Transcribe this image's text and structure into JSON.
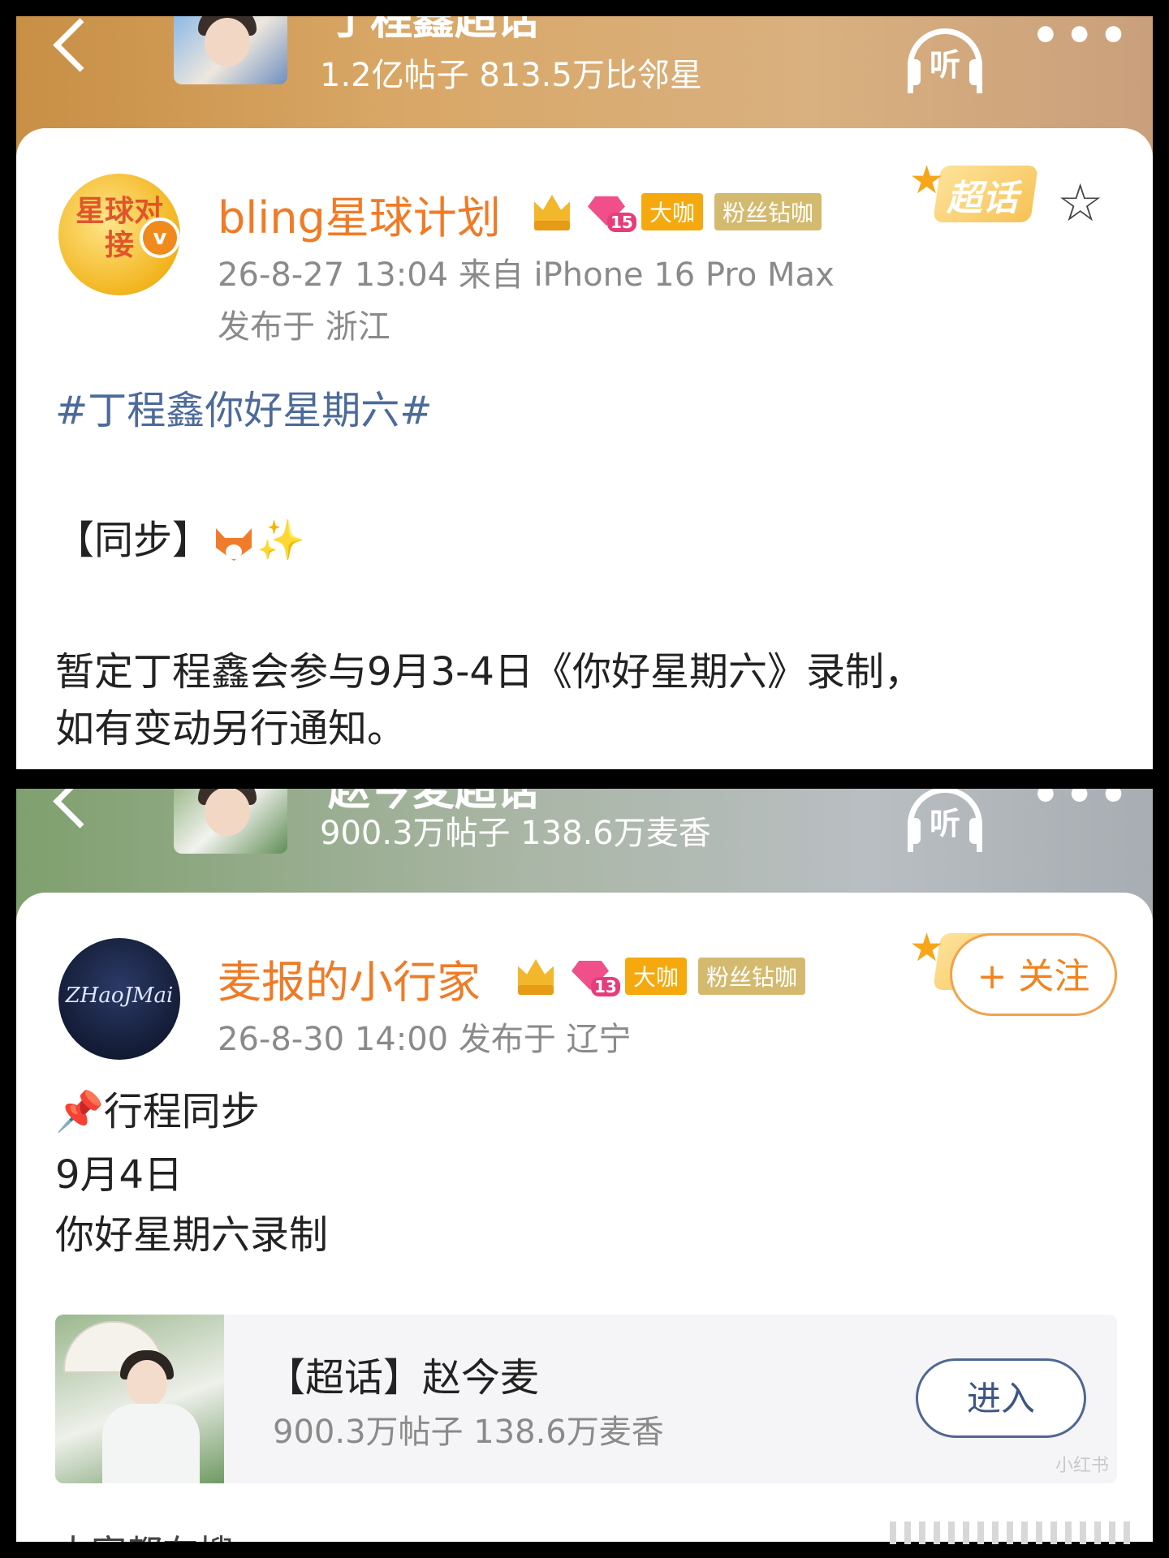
{
  "post1": {
    "header": {
      "topic_title": "丁程鑫超话",
      "stats": "1.2亿帖子 813.5万比邻星",
      "listen_label": "听",
      "more_label": "•••"
    },
    "author": {
      "avatar_text": "星球对接",
      "name": "bling星球计划",
      "crown_level": "",
      "gem_level": "15",
      "tag_gold": "大咖",
      "tag_fan": "粉丝钻咖",
      "verified_label": "v"
    },
    "chaohua_label": "超话",
    "meta_line1": "26-8-27 13:04  来自 iPhone 16 Pro Max",
    "meta_line2": "发布于 浙江",
    "content": {
      "hashtag": "#丁程鑫你好星期六#",
      "sync_label": "【同步】",
      "line1": "暂定丁程鑫会参与9月3-4日《你好星期六》录制，",
      "line2": "如有变动另行通知。"
    }
  },
  "post2": {
    "header": {
      "topic_title": "赵今麦超话",
      "stats": "900.3万帖子 138.6万麦香",
      "listen_label": "听",
      "more_label": "•••"
    },
    "author": {
      "avatar_text": "ZHaoJMai",
      "name": "麦报的小行家",
      "gem_level": "13",
      "tag_gold": "大咖",
      "tag_fan": "粉丝钻咖"
    },
    "follow_label": "+ 关注",
    "meta_line1": "26-8-30 14:00  发布于 辽宁",
    "content": {
      "line1": "行程同步",
      "line2": "9月4日",
      "line3": "你好星期六录制"
    },
    "topic_card": {
      "title": "【超话】赵今麦",
      "stats": "900.3万帖子 138.6万麦香",
      "enter_label": "进入"
    },
    "cut_text": "大家都在搜"
  },
  "watermark": "小红书"
}
